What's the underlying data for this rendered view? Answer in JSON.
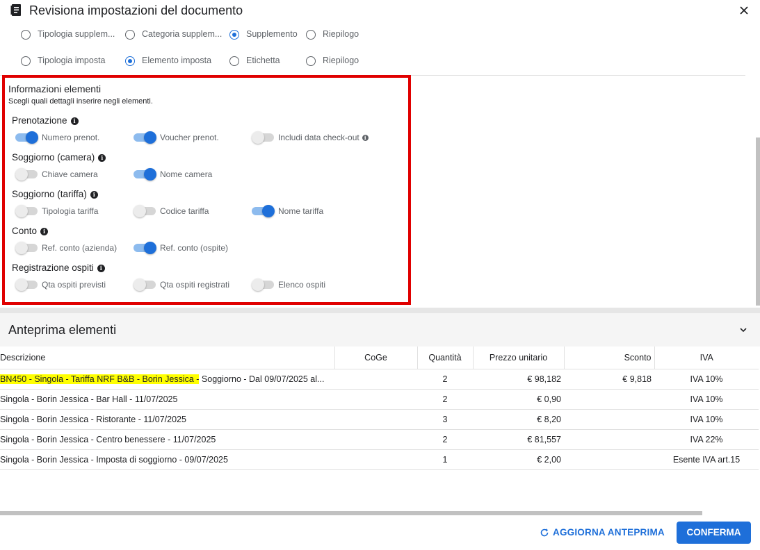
{
  "header": {
    "title": "Revisiona impostazioni del documento",
    "icon": "document-icon",
    "close_icon": "close-icon"
  },
  "steps_row1": [
    {
      "label": "Tipologia supplem...",
      "checked": false
    },
    {
      "label": "Categoria supplem...",
      "checked": false
    },
    {
      "label": "Supplemento",
      "checked": true
    },
    {
      "label": "Riepilogo",
      "checked": false
    }
  ],
  "steps_row2": [
    {
      "label": "Tipologia imposta",
      "checked": false
    },
    {
      "label": "Elemento imposta",
      "checked": true
    },
    {
      "label": "Etichetta",
      "checked": false
    },
    {
      "label": "Riepilogo",
      "checked": false
    }
  ],
  "info": {
    "title": "Informazioni elementi",
    "subtitle": "Scegli quali dettagli inserire negli elementi.",
    "groups": [
      {
        "title": "Prenotazione",
        "toggles": [
          {
            "label": "Numero prenot.",
            "on": true
          },
          {
            "label": "Voucher prenot.",
            "on": true
          },
          {
            "label": "Includi data check-out",
            "on": false
          }
        ]
      },
      {
        "title": "Soggiorno (camera)",
        "toggles": [
          {
            "label": "Chiave camera",
            "on": false
          },
          {
            "label": "Nome camera",
            "on": true
          }
        ]
      },
      {
        "title": "Soggiorno (tariffa)",
        "toggles": [
          {
            "label": "Tipologia tariffa",
            "on": false
          },
          {
            "label": "Codice tariffa",
            "on": false
          },
          {
            "label": "Nome tariffa",
            "on": true
          }
        ]
      },
      {
        "title": "Conto",
        "toggles": [
          {
            "label": "Ref. conto (azienda)",
            "on": false
          },
          {
            "label": "Ref. conto (ospite)",
            "on": true
          }
        ]
      },
      {
        "title": "Registrazione ospiti",
        "toggles": [
          {
            "label": "Qta ospiti previsti",
            "on": false
          },
          {
            "label": "Qta ospiti registrati",
            "on": false
          },
          {
            "label": "Elenco ospiti",
            "on": false
          }
        ]
      }
    ]
  },
  "preview": {
    "title": "Anteprima elementi",
    "columns": [
      "Descrizione",
      "CoGe",
      "Quantità",
      "Prezzo unitario",
      "Sconto",
      "IVA"
    ],
    "rows": [
      {
        "desc_highlight": "BN450 - Singola - Tariffa NRF B&B - Borin Jessica -",
        "desc": " Soggiorno - Dal 09/07/2025 al...",
        "coge": "",
        "qty": "2",
        "price": "€ 98,182",
        "discount": "€ 9,818",
        "vat": "IVA 10%"
      },
      {
        "desc_highlight": "",
        "desc": "Singola - Borin Jessica - Bar Hall - 11/07/2025",
        "coge": "",
        "qty": "2",
        "price": "€ 0,90",
        "discount": "",
        "vat": "IVA 10%"
      },
      {
        "desc_highlight": "",
        "desc": "Singola - Borin Jessica - Ristorante - 11/07/2025",
        "coge": "",
        "qty": "3",
        "price": "€ 8,20",
        "discount": "",
        "vat": "IVA 10%"
      },
      {
        "desc_highlight": "",
        "desc": "Singola - Borin Jessica - Centro benessere - 11/07/2025",
        "coge": "",
        "qty": "2",
        "price": "€ 81,557",
        "discount": "",
        "vat": "IVA 22%"
      },
      {
        "desc_highlight": "",
        "desc": "Singola - Borin Jessica - Imposta di soggiorno - 09/07/2025",
        "coge": "",
        "qty": "1",
        "price": "€ 2,00",
        "discount": "",
        "vat": "Esente IVA art.15"
      }
    ]
  },
  "footer": {
    "refresh_label": "AGGIORNA ANTEPRIMA",
    "confirm_label": "CONFERMA"
  },
  "colors": {
    "accent": "#1e6fd9",
    "highlight": "#ffff00",
    "frame": "#e00000"
  }
}
